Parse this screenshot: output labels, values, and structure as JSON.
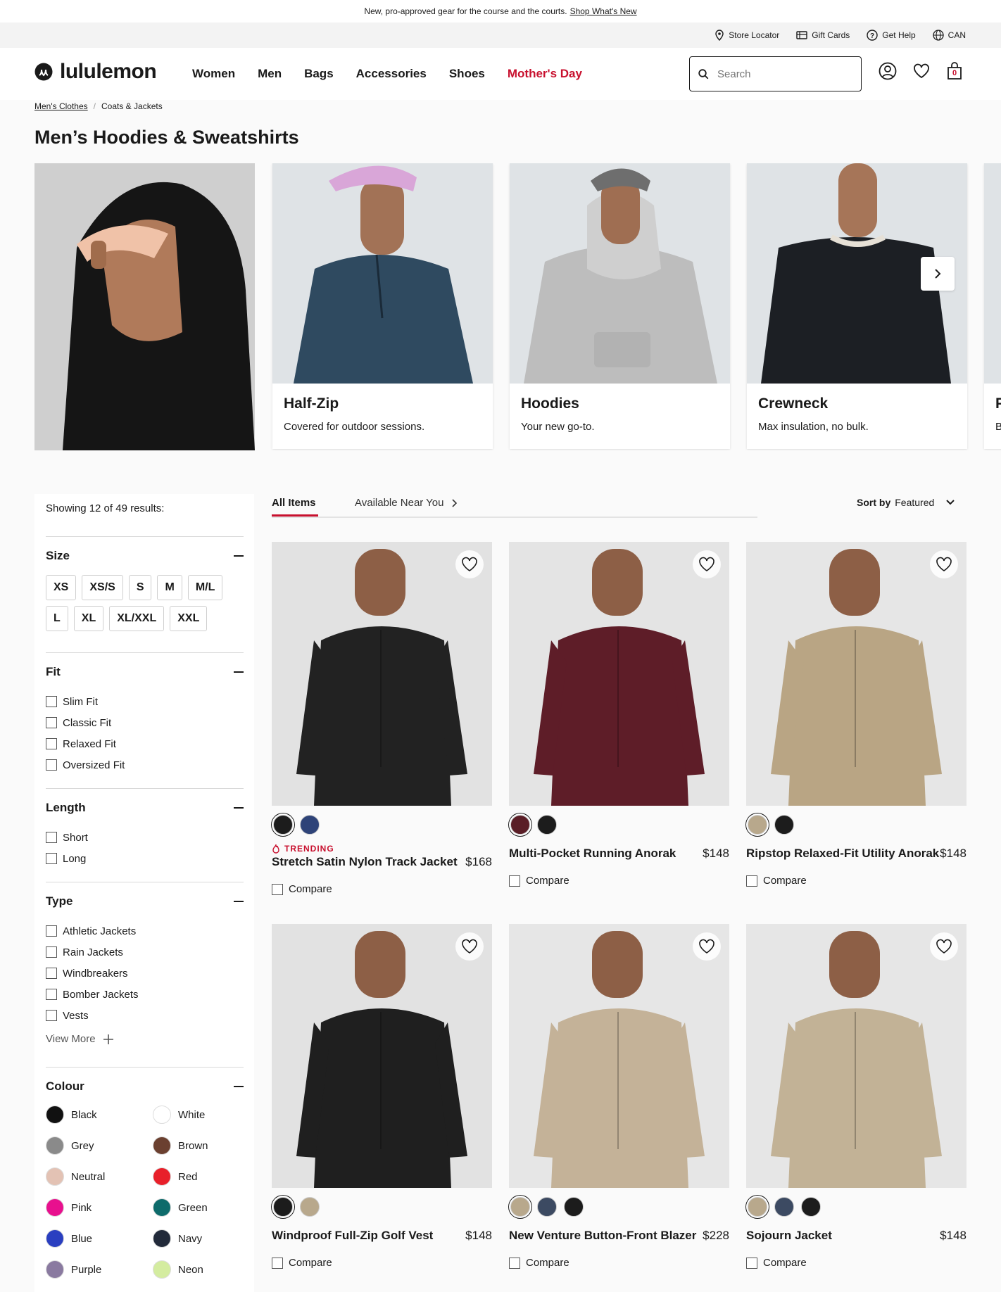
{
  "promo": {
    "text": "New, pro-approved gear for the course and the courts.",
    "link": "Shop What's New"
  },
  "utility": {
    "store_locator": "Store Locator",
    "gift_cards": "Gift Cards",
    "get_help": "Get Help",
    "region": "CAN"
  },
  "header": {
    "logo": "lululemon",
    "nav": [
      "Women",
      "Men",
      "Bags",
      "Accessories",
      "Shoes",
      "Mother's Day"
    ],
    "search_placeholder": "Search",
    "cart_count": "0"
  },
  "breadcrumb": [
    "Men's Clothes",
    "Coats & Jackets"
  ],
  "page_title": "Men’s Hoodies & Sweatshirts",
  "categories": [
    {
      "title": "Half-Zip",
      "subtitle": "Covered for outdoor sessions."
    },
    {
      "title": "Hoodies",
      "subtitle": "Your new go-to."
    },
    {
      "title": "Crewneck",
      "subtitle": "Max insulation, no bulk."
    },
    {
      "title": "P",
      "subtitle": "B"
    }
  ],
  "filters": {
    "showing": "Showing 12 of 49 results:",
    "size": {
      "title": "Size",
      "options": [
        "XS",
        "XS/S",
        "S",
        "M",
        "M/L",
        "L",
        "XL",
        "XL/XXL",
        "XXL"
      ]
    },
    "fit": {
      "title": "Fit",
      "options": [
        "Slim Fit",
        "Classic Fit",
        "Relaxed Fit",
        "Oversized Fit"
      ]
    },
    "length": {
      "title": "Length",
      "options": [
        "Short",
        "Long"
      ]
    },
    "type": {
      "title": "Type",
      "options": [
        "Athletic Jackets",
        "Rain Jackets",
        "Windbreakers",
        "Bomber Jackets",
        "Vests"
      ],
      "view_more": "View More"
    },
    "colour": {
      "title": "Colour",
      "options": [
        {
          "name": "Black",
          "color": "#111111"
        },
        {
          "name": "White",
          "color": "#ffffff"
        },
        {
          "name": "Grey",
          "color": "#8a8a8a"
        },
        {
          "name": "Brown",
          "color": "#6b4030"
        },
        {
          "name": "Neutral",
          "color": "#e3c2b4"
        },
        {
          "name": "Red",
          "color": "#e8202a"
        },
        {
          "name": "Pink",
          "color": "#e8108e"
        },
        {
          "name": "Green",
          "color": "#0e6b6b"
        },
        {
          "name": "Blue",
          "color": "#2a3fc0"
        },
        {
          "name": "Navy",
          "color": "#222a3a"
        },
        {
          "name": "Purple",
          "color": "#8a7aa0"
        },
        {
          "name": "Neon",
          "color": "#d4eca0"
        }
      ]
    }
  },
  "tabs": {
    "all": "All Items",
    "near": "Available Near You"
  },
  "sort": {
    "label": "Sort by",
    "value": "Featured"
  },
  "products": [
    {
      "name": "Stretch Satin Nylon Track Jacket",
      "price": "$168",
      "badge": "TRENDING",
      "compare": "Compare",
      "swatches": [
        "#1c1c1c",
        "#2e4378"
      ],
      "bg": "#e2e2e2",
      "garment": "#222222"
    },
    {
      "name": "Multi-Pocket Running Anorak",
      "price": "$148",
      "badge": "",
      "compare": "Compare",
      "swatches": [
        "#5a1e26",
        "#1c1c1c"
      ],
      "bg": "#e4e4e4",
      "garment": "#5e1d28"
    },
    {
      "name": "Ripstop Relaxed-Fit Utility Anorak",
      "price": "$148",
      "badge": "",
      "compare": "Compare",
      "swatches": [
        "#b8a88c",
        "#1c1c1c"
      ],
      "bg": "#e6e6e6",
      "garment": "#b9a584"
    },
    {
      "name": "Windproof Full-Zip Golf Vest",
      "price": "$148",
      "badge": "",
      "compare": "Compare",
      "swatches": [
        "#1c1c1c",
        "#b8a88c"
      ],
      "bg": "#e2e2e2",
      "garment": "#1f1f1f"
    },
    {
      "name": "New Venture Button-Front Blazer",
      "price": "$228",
      "badge": "",
      "compare": "Compare",
      "swatches": [
        "#b8a88c",
        "#3c4a62",
        "#1c1c1c"
      ],
      "bg": "#e6e6e6",
      "garment": "#c4b298"
    },
    {
      "name": "Sojourn Jacket",
      "price": "$148",
      "badge": "",
      "compare": "Compare",
      "swatches": [
        "#b8a88c",
        "#3c4a62",
        "#1c1c1c"
      ],
      "bg": "#e6e6e6",
      "garment": "#c2b296"
    }
  ]
}
